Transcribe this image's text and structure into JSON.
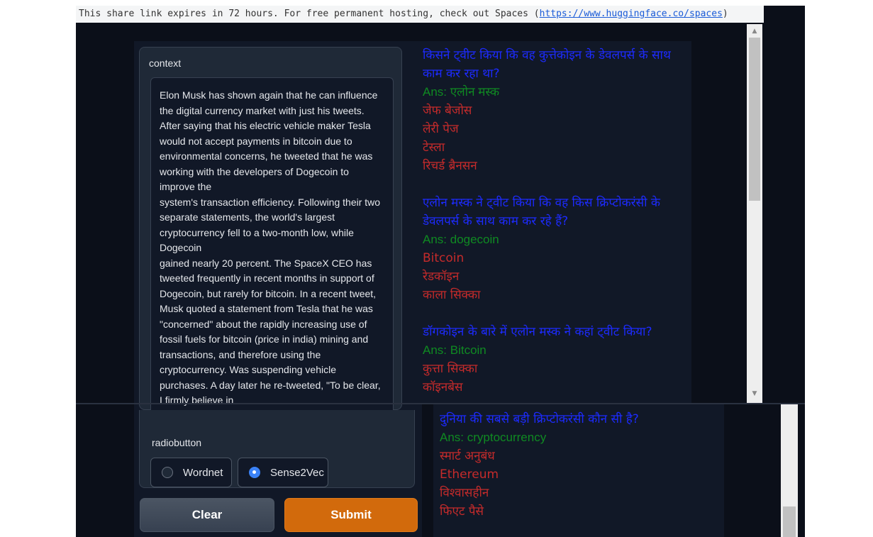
{
  "share_banner": {
    "text": "This share link expires in 72 hours. For free permanent hosting, check out Spaces (",
    "link_text": "https://www.huggingface.co/spaces",
    "suffix": ")"
  },
  "context": {
    "label": "context",
    "value": "Elon Musk has shown again that he can influence the digital currency market with just his tweets. After saying that his electric vehicle maker Tesla would not accept payments in bitcoin due to environmental concerns, he tweeted that he was working with the developers of Dogecoin to improve the\nsystem's transaction efficiency. Following their two separate statements, the world's largest cryptocurrency fell to a two-month low, while Dogecoin\ngained nearly 20 percent. The SpaceX CEO has tweeted frequently in recent months in support of Dogecoin, but rarely for bitcoin. In a recent tweet, Musk quoted a statement from Tesla that he was \"concerned\" about the rapidly increasing use of fossil fuels for bitcoin (price in india) mining and transactions, and therefore using the cryptocurrency. Was suspending vehicle purchases. A day later he re-tweeted, \"To be clear, I firmly believe in"
  },
  "radio": {
    "label": "radiobutton",
    "options": [
      {
        "label": "Wordnet",
        "selected": false
      },
      {
        "label": "Sense2Vec",
        "selected": true
      }
    ]
  },
  "buttons": {
    "clear": "Clear",
    "submit": "Submit"
  },
  "colors": {
    "question": "#1d2bff",
    "answer": "#0f8a22",
    "option": "#c52b2b",
    "submit": "#d26a0c"
  },
  "output": {
    "groups": [
      {
        "question": "किसने ट्वीट किया कि वह कुत्तेकोइन के डेवलपर्स के साथ काम कर रहा था?",
        "answer": "Ans: एलोन मस्क",
        "options": [
          "जेफ बेजोस",
          "लेरी पेज",
          "टेस्ला",
          "रिचर्ड ब्रैनसन"
        ]
      },
      {
        "question": "एलोन मस्क ने ट्वीट किया कि वह किस क्रिप्टोकरंसी के डेवलपर्स के साथ काम कर रहे हैं?",
        "answer": "Ans: dogecoin",
        "options": [
          "Bitcoin",
          "रेडकॉइन",
          "काला सिक्का"
        ]
      },
      {
        "question": "डॉगकोइन के बारे में एलोन मस्क ने कहां ट्वीट किया?",
        "answer": "Ans: Bitcoin",
        "options": [
          "कुत्ता सिक्का",
          "कॉइनबेस"
        ]
      }
    ],
    "lower_group": {
      "question": "दुनिया की सबसे बड़ी क्रिप्टोकरंसी कौन सी है?",
      "answer": "Ans: cryptocurrency",
      "options": [
        "स्मार्ट अनुबंध",
        "Ethereum",
        "विश्वासहीन",
        "फिएट पैसे"
      ]
    }
  }
}
